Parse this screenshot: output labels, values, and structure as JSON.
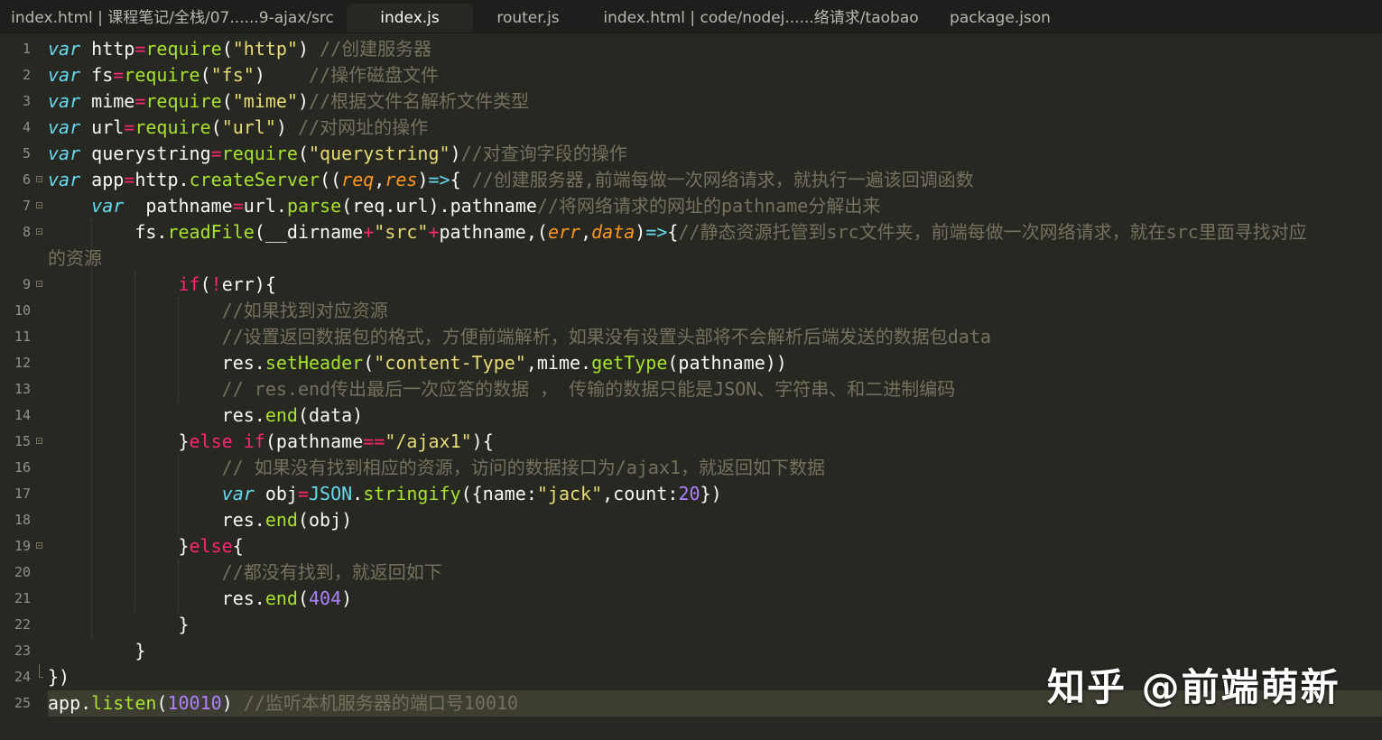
{
  "tabs": [
    {
      "label": "index.html | 课程笔记/全栈/07......9-ajax/src",
      "active": false
    },
    {
      "label": "index.js",
      "active": true
    },
    {
      "label": "router.js",
      "active": false
    },
    {
      "label": "index.html | code/nodej......络请求/taobao",
      "active": false
    },
    {
      "label": "package.json",
      "active": false
    }
  ],
  "colors": {
    "background": "#272822",
    "keyword": "#66d9ef",
    "operator": "#f92672",
    "string": "#e6db74",
    "function": "#a6e22e",
    "parameter": "#fd971f",
    "number": "#ae81ff",
    "comment": "#75715e",
    "text": "#f8f8f2"
  },
  "gutter": {
    "line_numbers": [
      "1",
      "2",
      "3",
      "4",
      "5",
      "6",
      "7",
      "8",
      "9",
      "10",
      "11",
      "12",
      "13",
      "14",
      "15",
      "16",
      "17",
      "18",
      "19",
      "20",
      "21",
      "22",
      "23",
      "24",
      "25"
    ]
  },
  "code": {
    "lines": [
      [
        [
          "kw",
          "var"
        ],
        [
          "txt",
          " http"
        ],
        [
          "op",
          "="
        ],
        [
          "fn",
          "require"
        ],
        [
          "txt",
          "("
        ],
        [
          "str",
          "\"http\""
        ],
        [
          "txt",
          ") "
        ],
        [
          "com",
          "//创建服务器"
        ]
      ],
      [
        [
          "kw",
          "var"
        ],
        [
          "txt",
          " fs"
        ],
        [
          "op",
          "="
        ],
        [
          "fn",
          "require"
        ],
        [
          "txt",
          "("
        ],
        [
          "str",
          "\"fs\""
        ],
        [
          "txt",
          ")    "
        ],
        [
          "com",
          "//操作磁盘文件"
        ]
      ],
      [
        [
          "kw",
          "var"
        ],
        [
          "txt",
          " mime"
        ],
        [
          "op",
          "="
        ],
        [
          "fn",
          "require"
        ],
        [
          "txt",
          "("
        ],
        [
          "str",
          "\"mime\""
        ],
        [
          "txt",
          ")"
        ],
        [
          "com",
          "//根据文件名解析文件类型"
        ]
      ],
      [
        [
          "kw",
          "var"
        ],
        [
          "txt",
          " url"
        ],
        [
          "op",
          "="
        ],
        [
          "fn",
          "require"
        ],
        [
          "txt",
          "("
        ],
        [
          "str",
          "\"url\""
        ],
        [
          "txt",
          ") "
        ],
        [
          "com",
          "//对网址的操作"
        ]
      ],
      [
        [
          "kw",
          "var"
        ],
        [
          "txt",
          " querystring"
        ],
        [
          "op",
          "="
        ],
        [
          "fn",
          "require"
        ],
        [
          "txt",
          "("
        ],
        [
          "str",
          "\"querystring\""
        ],
        [
          "txt",
          ")"
        ],
        [
          "com",
          "//对查询字段的操作"
        ]
      ],
      [
        [
          "kw",
          "var"
        ],
        [
          "txt",
          " app"
        ],
        [
          "op",
          "="
        ],
        [
          "txt",
          "http."
        ],
        [
          "fn",
          "createServer"
        ],
        [
          "txt",
          "(("
        ],
        [
          "par",
          "req"
        ],
        [
          "txt",
          ","
        ],
        [
          "par",
          "res"
        ],
        [
          "txt",
          ")"
        ],
        [
          "sup",
          "=>"
        ],
        [
          "txt",
          "{ "
        ],
        [
          "com",
          "//创建服务器,前端每做一次网络请求，就执行一遍该回调函数"
        ]
      ],
      [
        [
          "txt",
          "    "
        ],
        [
          "kw",
          "var"
        ],
        [
          "txt",
          "  pathname"
        ],
        [
          "op",
          "="
        ],
        [
          "txt",
          "url."
        ],
        [
          "fn",
          "parse"
        ],
        [
          "txt",
          "(req.url).pathname"
        ],
        [
          "com",
          "//将网络请求的网址的pathname分解出来"
        ]
      ],
      [
        [
          "txt",
          "        fs."
        ],
        [
          "fn",
          "readFile"
        ],
        [
          "txt",
          "(__dirname"
        ],
        [
          "op",
          "+"
        ],
        [
          "str",
          "\"src\""
        ],
        [
          "op",
          "+"
        ],
        [
          "txt",
          "pathname,("
        ],
        [
          "par",
          "err"
        ],
        [
          "txt",
          ","
        ],
        [
          "par",
          "data"
        ],
        [
          "txt",
          ")"
        ],
        [
          "sup",
          "=>"
        ],
        [
          "txt",
          "{"
        ],
        [
          "com",
          "//静态资源托管到src文件夹，前端每做一次网络请求，就在src里面寻找对应"
        ]
      ],
      [
        [
          "txt",
          "            "
        ],
        [
          "cf",
          "if"
        ],
        [
          "txt",
          "("
        ],
        [
          "op",
          "!"
        ],
        [
          "txt",
          "err){"
        ]
      ],
      [
        [
          "txt",
          "                "
        ],
        [
          "com",
          "//如果找到对应资源"
        ]
      ],
      [
        [
          "txt",
          "                "
        ],
        [
          "com",
          "//设置返回数据包的格式，方便前端解析，如果没有设置头部将不会解析后端发送的数据包data"
        ]
      ],
      [
        [
          "txt",
          "                res."
        ],
        [
          "fn",
          "setHeader"
        ],
        [
          "txt",
          "("
        ],
        [
          "str",
          "\"content-Type\""
        ],
        [
          "txt",
          ",mime."
        ],
        [
          "fn",
          "getType"
        ],
        [
          "txt",
          "(pathname))"
        ]
      ],
      [
        [
          "txt",
          "                "
        ],
        [
          "com",
          "// res.end传出最后一次应答的数据 ， 传输的数据只能是JSON、字符串、和二进制编码"
        ]
      ],
      [
        [
          "txt",
          "                res."
        ],
        [
          "fn",
          "end"
        ],
        [
          "txt",
          "(data)"
        ]
      ],
      [
        [
          "txt",
          "            }"
        ],
        [
          "cf",
          "else"
        ],
        [
          "txt",
          " "
        ],
        [
          "cf",
          "if"
        ],
        [
          "txt",
          "(pathname"
        ],
        [
          "op",
          "=="
        ],
        [
          "str",
          "\"/ajax1\""
        ],
        [
          "txt",
          "){"
        ]
      ],
      [
        [
          "txt",
          "                "
        ],
        [
          "com",
          "// 如果没有找到相应的资源，访问的数据接口为/ajax1，就返回如下数据"
        ]
      ],
      [
        [
          "txt",
          "                "
        ],
        [
          "kw",
          "var"
        ],
        [
          "txt",
          " obj"
        ],
        [
          "op",
          "="
        ],
        [
          "sup",
          "JSON"
        ],
        [
          "txt",
          "."
        ],
        [
          "fn",
          "stringify"
        ],
        [
          "txt",
          "({name:"
        ],
        [
          "str",
          "\"jack\""
        ],
        [
          "txt",
          ",count:"
        ],
        [
          "num",
          "20"
        ],
        [
          "txt",
          "})"
        ]
      ],
      [
        [
          "txt",
          "                res."
        ],
        [
          "fn",
          "end"
        ],
        [
          "txt",
          "(obj)"
        ]
      ],
      [
        [
          "txt",
          "            }"
        ],
        [
          "cf",
          "else"
        ],
        [
          "txt",
          "{"
        ]
      ],
      [
        [
          "txt",
          "                "
        ],
        [
          "com",
          "//都没有找到，就返回如下"
        ]
      ],
      [
        [
          "txt",
          "                res."
        ],
        [
          "fn",
          "end"
        ],
        [
          "txt",
          "("
        ],
        [
          "num",
          "404"
        ],
        [
          "txt",
          ")"
        ]
      ],
      [
        [
          "txt",
          "            }"
        ]
      ],
      [
        [
          "txt",
          "        }"
        ]
      ],
      [
        [
          "txt",
          "})"
        ]
      ],
      [
        [
          "txt",
          "app."
        ],
        [
          "fn",
          "listen"
        ],
        [
          "txt",
          "("
        ],
        [
          "num",
          "10010"
        ],
        [
          "txt",
          ") "
        ],
        [
          "com",
          "//监听本机服务器的端口号10010"
        ]
      ]
    ],
    "wrap_continuation": "的资源"
  },
  "watermark": "知乎 @前端萌新"
}
